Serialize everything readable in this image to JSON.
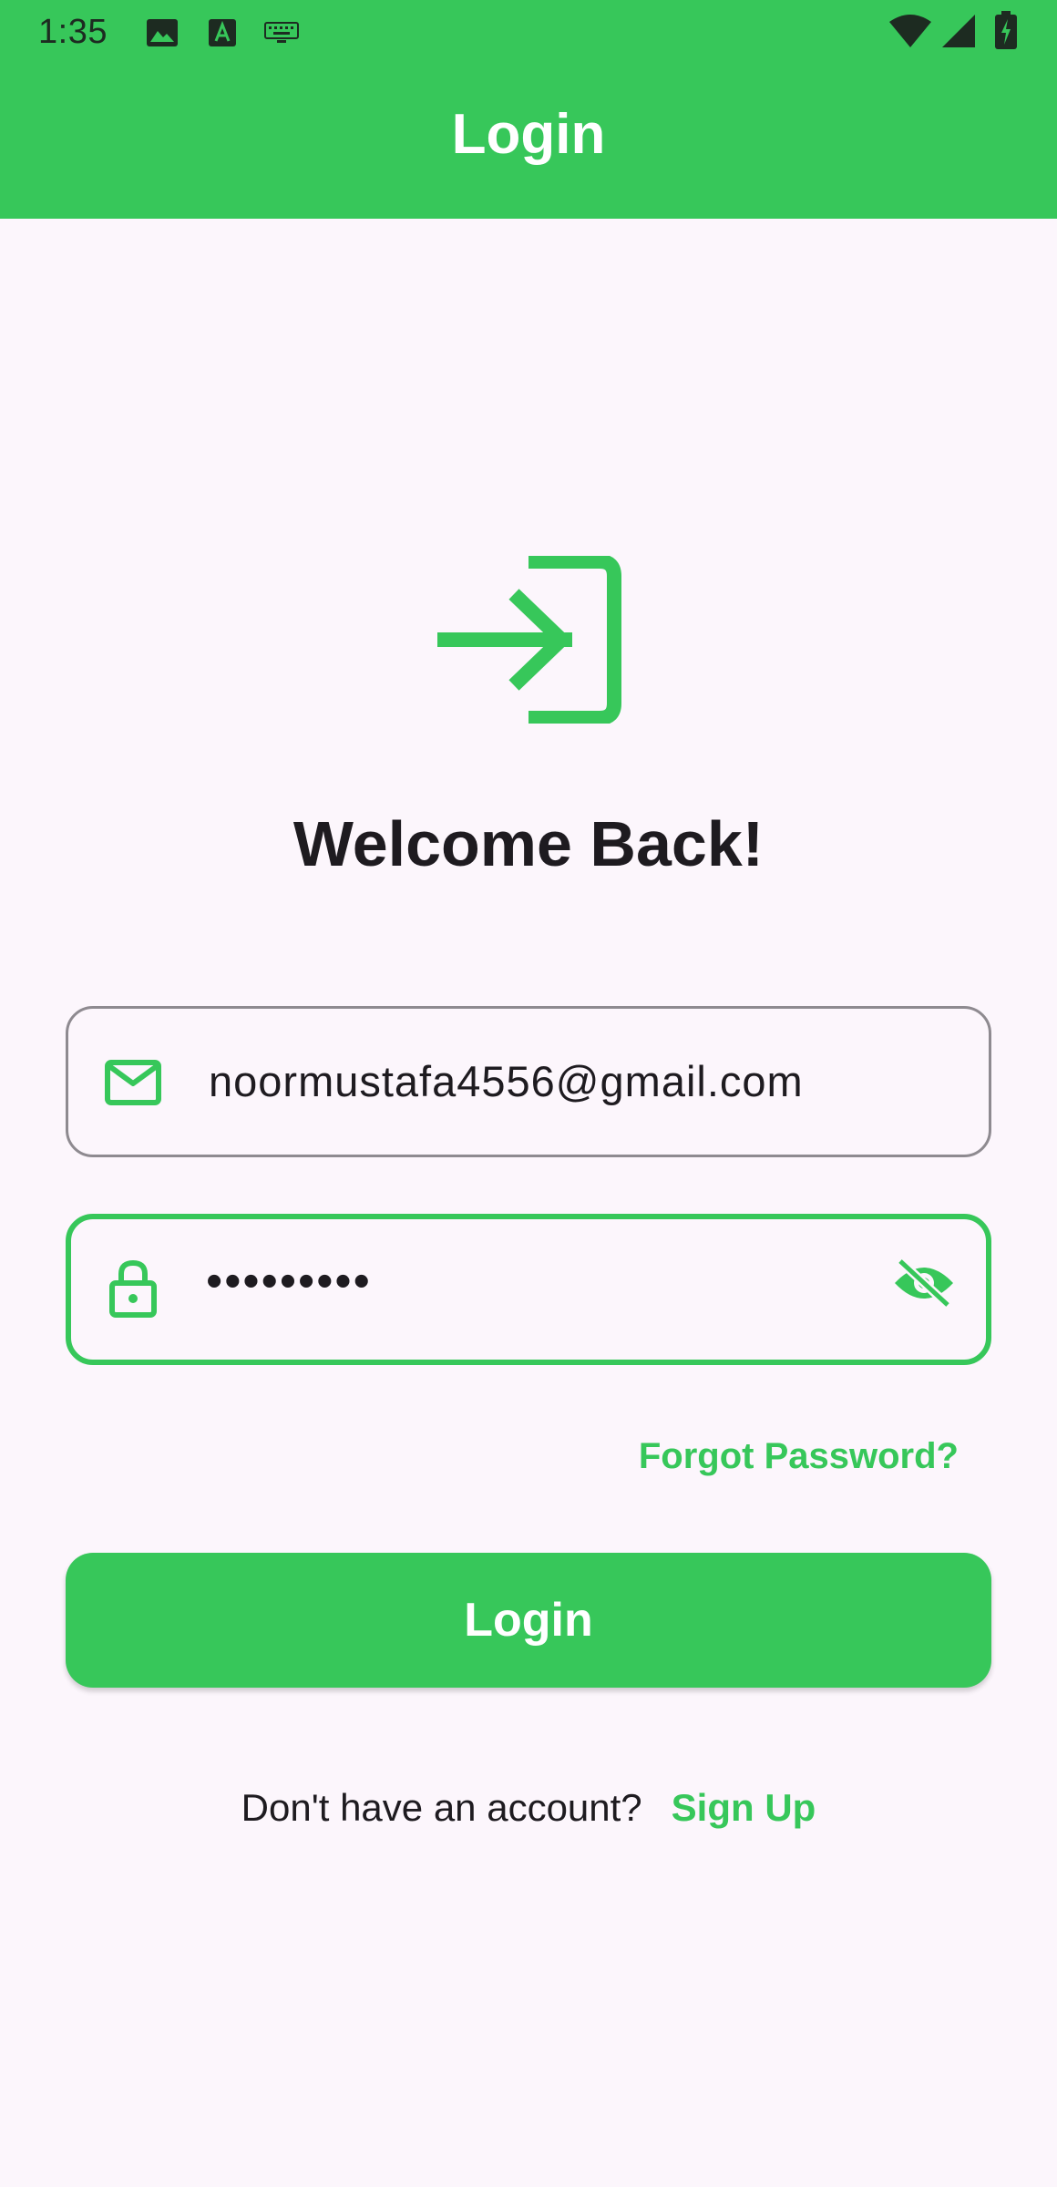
{
  "colors": {
    "accent": "#37C75A",
    "background": "#FCF6FC",
    "text": "#1E1B20"
  },
  "status_bar": {
    "time": "1:35",
    "left_icons": [
      "image-icon",
      "font-download-icon",
      "keyboard-icon"
    ],
    "right_icons": [
      "wifi-icon",
      "cellular-signal-icon",
      "battery-charging-icon"
    ]
  },
  "app_bar": {
    "title": "Login"
  },
  "hero": {
    "icon": "login-icon",
    "heading": "Welcome Back!"
  },
  "form": {
    "email": {
      "icon": "mail-icon",
      "value": "noormustafa4556@gmail.com"
    },
    "password": {
      "icon": "lock-icon",
      "value": "•••••••••",
      "toggle_icon": "visibility-off-icon"
    },
    "forgot_password": "Forgot Password?",
    "submit_label": "Login"
  },
  "footer": {
    "prompt": "Don't have an account?",
    "signup_label": "Sign Up"
  }
}
